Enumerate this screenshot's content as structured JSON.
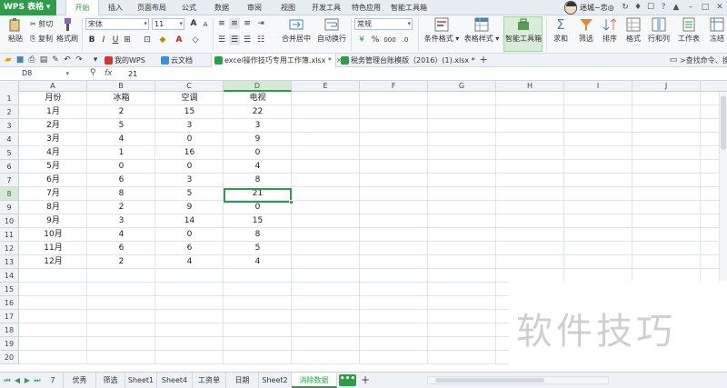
{
  "app": {
    "logo_text": "WPS 表格",
    "accent": "#2e9c4a"
  },
  "menu": {
    "tabs": [
      "开始",
      "插入",
      "页面布局",
      "公式",
      "数据",
      "审阅",
      "视图",
      "开发工具",
      "特色应用",
      "智能工具箱"
    ],
    "active_index": 0,
    "user_name": "迷城~恋◎"
  },
  "ribbon": {
    "clipboard": {
      "paste": "粘贴",
      "cut": "剪切",
      "copy": "复制",
      "format_painter": "格式刷"
    },
    "font_name": "宋体",
    "font_size": "11",
    "number_format": "常规",
    "merge_center": "合并居中",
    "wrap_text": "自动换行",
    "percent": "%",
    "thousands": "000",
    "conditional_format": "条件格式",
    "table_style": "表格样式",
    "smart_toolbox": "智能工具箱",
    "sum": "求和",
    "filter": "筛选",
    "sort": "排序",
    "format": "格式",
    "row_col": "行和列",
    "worksheet": "工作表",
    "freeze": "冻结"
  },
  "doc_tabs": [
    {
      "label": "我的WPS",
      "close": false
    },
    {
      "label": "云文档",
      "close": false
    },
    {
      "label": "excel操作技巧专用工作簿.xlsx *",
      "close": true,
      "active": true
    },
    {
      "label": "税务管理台账模版（2016）(1).xlsx *",
      "close": true
    }
  ],
  "cmd_search": ">查找命令、搜索模板",
  "formula_bar": {
    "cell_ref": "D8",
    "fx": "fx",
    "value": "21"
  },
  "grid": {
    "columns": [
      "A",
      "B",
      "C",
      "D",
      "E",
      "F",
      "G",
      "H",
      "I",
      "J"
    ],
    "selected_column": "D",
    "rows": [
      "1",
      "2",
      "3",
      "4",
      "5",
      "6",
      "7",
      "8",
      "9",
      "10",
      "11",
      "12",
      "13",
      "14",
      "15",
      "16",
      "17",
      "18",
      "19",
      "20"
    ],
    "selected_row": "8",
    "selected_cell": "D8",
    "header": [
      "月份",
      "冰箱",
      "空调",
      "电视"
    ],
    "data": [
      [
        "1月",
        "2",
        "15",
        "22"
      ],
      [
        "2月",
        "5",
        "3",
        "3"
      ],
      [
        "3月",
        "4",
        "0",
        "9"
      ],
      [
        "4月",
        "1",
        "16",
        "0"
      ],
      [
        "5月",
        "0",
        "0",
        "4"
      ],
      [
        "6月",
        "6",
        "3",
        "8"
      ],
      [
        "7月",
        "8",
        "5",
        "21"
      ],
      [
        "8月",
        "2",
        "9",
        "0"
      ],
      [
        "9月",
        "3",
        "14",
        "15"
      ],
      [
        "10月",
        "4",
        "0",
        "8"
      ],
      [
        "11月",
        "6",
        "6",
        "5"
      ],
      [
        "12月",
        "2",
        "4",
        "4"
      ]
    ]
  },
  "sheet_tabs": [
    "7",
    "优秀",
    "筛选",
    "Sheet1",
    "Sheet4",
    "工资单",
    "日期",
    "Sheet2",
    "消除数据"
  ],
  "active_sheet": "消除数据",
  "more_sheets": "•••",
  "add_sheet": "+",
  "watermark": "软件技巧"
}
